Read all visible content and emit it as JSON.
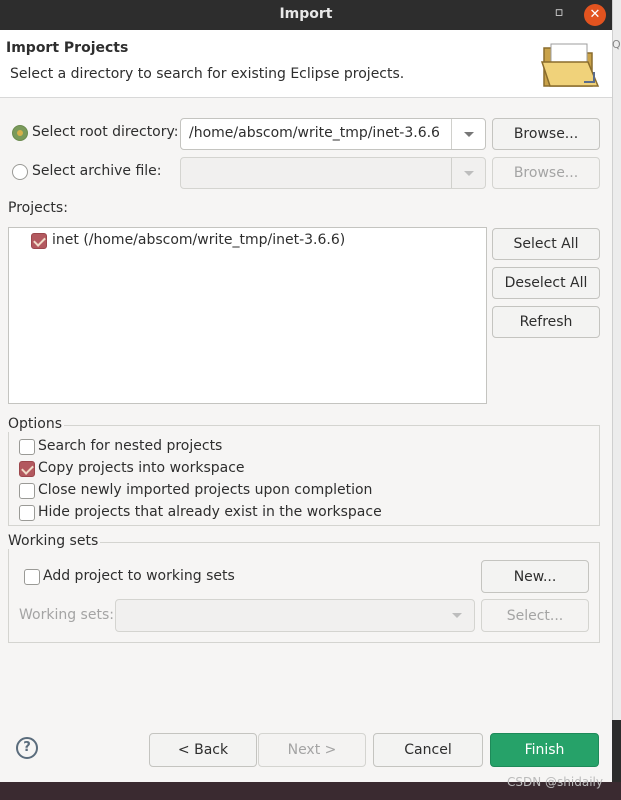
{
  "window": {
    "title": "Import",
    "minimize_glyph": "▫",
    "close_glyph": "✕",
    "side_fragment": "Q"
  },
  "banner": {
    "heading": "Import Projects",
    "description": "Select a directory to search for existing Eclipse projects.",
    "icon": "folder-icon"
  },
  "source": {
    "root_directory": {
      "label": "Select root directory:",
      "value": "/home/abscom/write_tmp/inet-3.6.6",
      "browse": "Browse...",
      "selected": true
    },
    "archive_file": {
      "label": "Select archive file:",
      "value": "",
      "browse": "Browse...",
      "selected": false
    }
  },
  "projects": {
    "label": "Projects:",
    "items": [
      {
        "label": "inet (/home/abscom/write_tmp/inet-3.6.6)",
        "checked": true
      }
    ],
    "buttons": {
      "select_all": "Select All",
      "deselect_all": "Deselect All",
      "refresh": "Refresh"
    }
  },
  "options": {
    "label": "Options",
    "items": [
      {
        "label": "Search for nested projects",
        "checked": false
      },
      {
        "label": "Copy projects into workspace",
        "checked": true
      },
      {
        "label": "Close newly imported projects upon completion",
        "checked": false
      },
      {
        "label": "Hide projects that already exist in the workspace",
        "checked": false
      }
    ]
  },
  "working_sets": {
    "label": "Working sets",
    "add_label": "Add project to working sets",
    "add_checked": false,
    "new_button": "New...",
    "sets_label": "Working sets:",
    "sets_value": "",
    "select_button": "Select..."
  },
  "footer": {
    "help": "?",
    "back": "< Back",
    "next": "Next >",
    "cancel": "Cancel",
    "finish": "Finish"
  },
  "watermark": "CSDN @shidaily",
  "colors": {
    "finish": "#26a269",
    "close": "#e2531f",
    "check": "#b3595f"
  }
}
